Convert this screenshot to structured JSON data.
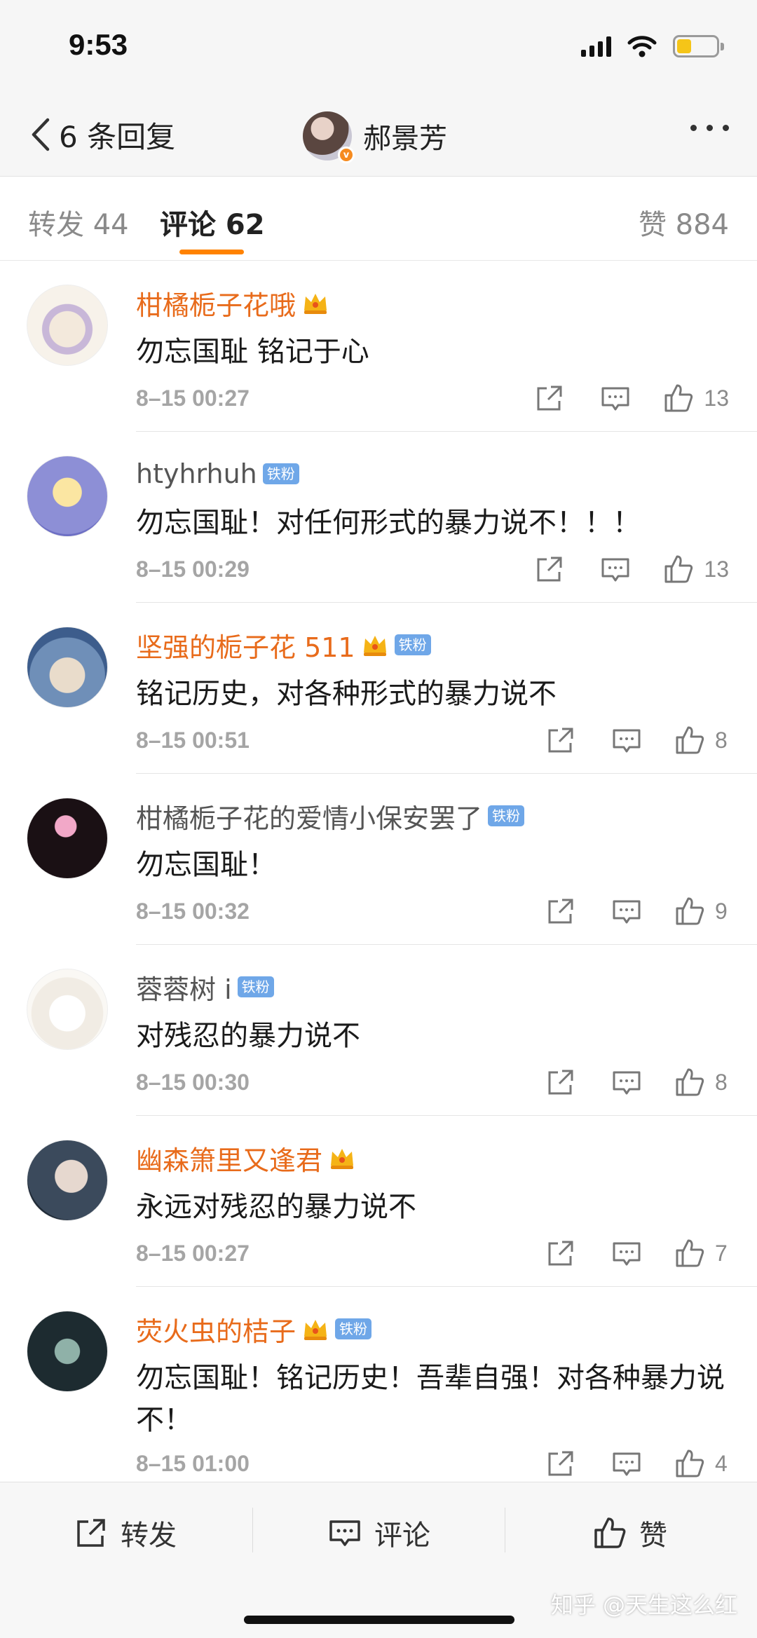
{
  "status": {
    "time": "9:53"
  },
  "nav": {
    "back_count": "6 条回复",
    "author": "郝景芳"
  },
  "tabs": {
    "repost": "转发 44",
    "comment": "评论 62",
    "like": "赞 884"
  },
  "comments": [
    {
      "name": "柑橘栀子花哦",
      "vip": true,
      "crown": true,
      "badge": "",
      "text": "勿忘国耻 铭记于心",
      "time": "8–15 00:27",
      "likes": "13"
    },
    {
      "name": "htyhrhuh",
      "vip": false,
      "crown": false,
      "badge": "铁粉",
      "text": "勿忘国耻！对任何形式的暴力说不！！！",
      "time": "8–15 00:29",
      "likes": "13"
    },
    {
      "name": "坚强的栀子花 511",
      "vip": true,
      "crown": true,
      "badge": "铁粉",
      "text": "铭记历史，对各种形式的暴力说不",
      "time": "8–15 00:51",
      "likes": "8"
    },
    {
      "name": "柑橘栀子花的爱情小保安罢了",
      "vip": false,
      "crown": false,
      "badge": "铁粉",
      "text": "勿忘国耻！",
      "time": "8–15 00:32",
      "likes": "9"
    },
    {
      "name": "蓉蓉树 i",
      "vip": false,
      "crown": false,
      "badge": "铁粉",
      "text": "对残忍的暴力说不",
      "time": "8–15 00:30",
      "likes": "8"
    },
    {
      "name": "幽森箫里又逢君",
      "vip": true,
      "crown": true,
      "badge": "",
      "text": "永远对残忍的暴力说不",
      "time": "8–15 00:27",
      "likes": "7"
    },
    {
      "name": "荧火虫的桔子",
      "vip": true,
      "crown": true,
      "badge": "铁粉",
      "text": "勿忘国耻！铭记历史！吾辈自强！对各种暴力说不！",
      "time": "8–15 01:00",
      "likes": "4"
    }
  ],
  "bottom": {
    "repost": "转发",
    "comment": "评论",
    "like": "赞"
  },
  "watermark": "知乎 @天生这么红",
  "colors": {
    "accent": "#ff8200",
    "vip_name": "#e86b1b",
    "badge": "#6fa7e8"
  }
}
